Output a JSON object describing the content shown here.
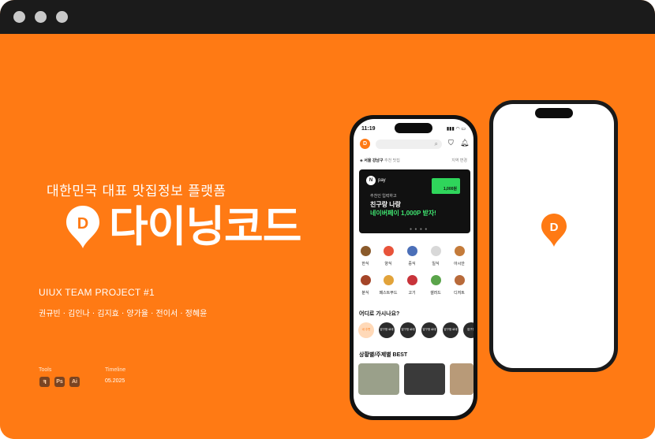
{
  "colors": {
    "accent": "#FF7A14",
    "titlebar": "#1b1b1b"
  },
  "hero": {
    "tagline": "대한민국 대표 맛집정보 플랫폼",
    "brand": "다이닝코드",
    "logo_letter": "D",
    "project": "UIUX TEAM PROJECT #1",
    "members": "권규빈 · 김인나 · 김지효 · 양가율 · 전이서 · 정혜윤",
    "tools_label": "Tools",
    "tools": [
      "Figma",
      "Ps",
      "Ai"
    ],
    "timeline_label": "Timeline",
    "timeline_value": "05.2025"
  },
  "phone": {
    "time": "11:19",
    "status_icons": "▮▮▮ ◠ ▭",
    "logo": "D",
    "location": "서울 강남구",
    "location_sub": "추천 맛집",
    "location_change": "지역 변경",
    "banner": {
      "pay": "pay",
      "line1": "추천인 입력하고",
      "line2": "친구랑 나랑",
      "line3": "네이버페이 1,000P 받자!",
      "coupon": "1,000원",
      "pager": "● ● ● ●"
    },
    "categories": [
      "한식",
      "양식",
      "중식",
      "일식",
      "아시안",
      "분식",
      "패스트푸드",
      "고기",
      "샐러드",
      "디저트"
    ],
    "section1": "어디로 가시나요?",
    "places": [
      "내 주변",
      "압구정 로데",
      "압구정 로데",
      "압구정 로데",
      "압구정 로데",
      "압구정"
    ],
    "section2": "상황별/주제별 BEST"
  }
}
